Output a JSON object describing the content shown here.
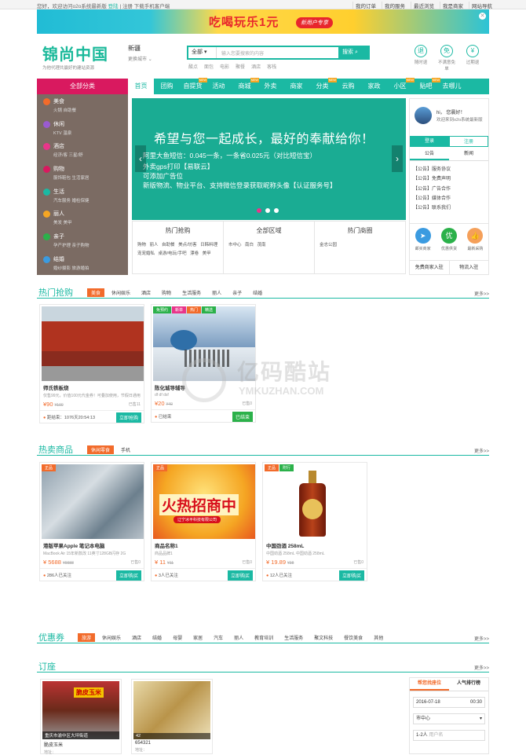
{
  "topbar": {
    "welcome": "您好，欢迎访问o2o系统最新版",
    "login": "登陆",
    "register": "注册",
    "download": "下载手机客户端",
    "links": [
      "我的订单",
      "我的服务",
      "最近浏览",
      "我是商家",
      "网站导航"
    ]
  },
  "banner": {
    "title": "吃喝玩乐1元",
    "sub": "新用户专享"
  },
  "logo": {
    "name": "锦尚中国",
    "slogan": "为他代理共赢好的建站资源"
  },
  "city": {
    "name": "新疆",
    "switch": "更换城市"
  },
  "search": {
    "select": "全部",
    "placeholder": "输入您要搜索的内容",
    "button": "搜索",
    "hot": [
      "酸点",
      "面包",
      "电影",
      "聚餐",
      "酒店",
      "客栈"
    ]
  },
  "badges": [
    {
      "c": "退",
      "t": "随时退"
    },
    {
      "c": "免",
      "t": "不满意免单"
    },
    {
      "c": "¥",
      "t": "过期退"
    }
  ],
  "nav": {
    "all": "全部分类",
    "items": [
      {
        "l": "首页",
        "n": false
      },
      {
        "l": "团购",
        "n": false
      },
      {
        "l": "自提货",
        "n": true
      },
      {
        "l": "活动",
        "n": false
      },
      {
        "l": "商城",
        "n": true
      },
      {
        "l": "外卖",
        "n": false
      },
      {
        "l": "商家",
        "n": false
      },
      {
        "l": "分类",
        "n": true
      },
      {
        "l": "云购",
        "n": false
      },
      {
        "l": "家政",
        "n": false
      },
      {
        "l": "小区",
        "n": true
      },
      {
        "l": "贴吧",
        "n": true
      },
      {
        "l": "去哪儿",
        "n": false
      }
    ]
  },
  "cats": [
    {
      "h": "美食",
      "s": "火锅  自助餐",
      "c": "#f26b2b"
    },
    {
      "h": "休闲",
      "s": "KTV  温泉",
      "c": "#9a5bd1"
    },
    {
      "h": "酒店",
      "s": "经济/客  三星/舒",
      "c": "#e8358a"
    },
    {
      "h": "购物",
      "s": "服饰鞋包  生活家居",
      "c": "#d9195f"
    },
    {
      "h": "生活",
      "s": "汽车服务  婚检保健",
      "c": "#1bb9a3"
    },
    {
      "h": "丽人",
      "s": "美发  美甲",
      "c": "#f5a623"
    },
    {
      "h": "亲子",
      "s": "孕产护理  亲子购物",
      "c": "#2bb14a"
    },
    {
      "h": "结婚",
      "s": "婚纱摄影  旅游婚拍",
      "c": "#3b9be0"
    }
  ],
  "slide": {
    "headline": "希望与您一起成长，最好的奉献给你！",
    "lines": [
      "阿里大鱼短信：0.045一条，一条省0.025元（对比短信宝）",
      "外卖gps打印【易联云】",
      "可添加广告位",
      "新版物流、物业平台、支持微信登录获取昵称头像【认证服务号】"
    ]
  },
  "quick": [
    {
      "h": "热门抢购",
      "l": "购物  丽人  自助餐  美点/坊客  日韩料理  宠宠婚私  桌游/电玩/手吧  漂卷  美甲"
    },
    {
      "h": "全部区域",
      "l": "市中心  南白  茂南"
    },
    {
      "h": "热门商圈",
      "l": "金志公园"
    }
  ],
  "user": {
    "hi": "hi，  您晨好！",
    "welcome": "欢迎来到o2o系统最新版",
    "login": "登录",
    "register": "注册",
    "tabs": [
      "公告",
      "新闻"
    ],
    "ann": [
      "【公告】服务协议",
      "【公告】免费声明",
      "【公告】广告合作",
      "【公告】媒体合作",
      "【公告】联系我们"
    ],
    "icons": [
      {
        "c": "➤",
        "t": "邮买商家",
        "col": "#3b9be0"
      },
      {
        "c": "优",
        "t": "优惠供货",
        "col": "#2bb14a"
      },
      {
        "c": "👍",
        "t": "最新采购",
        "col": "#f26b2b"
      }
    ],
    "foot": [
      "免费商家入驻",
      "物流入驻"
    ]
  },
  "sec1": {
    "title": "热门抢购",
    "tags": [
      "美食",
      "休闲娱乐",
      "酒店",
      "购物",
      "生活服务",
      "丽人",
      "亲子",
      "结婚"
    ],
    "more": "更多>>"
  },
  "sec2": {
    "title": "热卖商品",
    "tags": [
      "休闲零食",
      "手机"
    ],
    "more": "更多>>"
  },
  "sec3": {
    "title": "优惠券",
    "tags": [
      "旅游",
      "休闲娱乐",
      "酒店",
      "结婚",
      "母婴",
      "家居",
      "汽车",
      "丽人",
      "教育培训",
      "生活服务",
      "聚文科技",
      "餐饮美食",
      "其他"
    ],
    "more": "更多>>"
  },
  "sec4": {
    "title": "订座",
    "more": "更多>>"
  },
  "deals": [
    {
      "nm": "师氏铁板烧",
      "ds": "仅售99元，价值100元代金券！可叠加使用，节假日通用",
      "pr": "¥90",
      "old": "¥100",
      "sold": "已售11",
      "l": "距结束：1076天20:54:13",
      "b": "立即抢购",
      "tags": []
    },
    {
      "nm": "陈化城导辅导",
      "ds": "df df  dsf",
      "pr": "¥20",
      "old": "¥40",
      "sold": "已售0",
      "l": "已结束",
      "b": "已结束",
      "tags": [
        {
          "t": "免预约",
          "c": "#2bb14a"
        },
        {
          "t": "新单",
          "c": "#e8358a"
        },
        {
          "t": "热门",
          "c": "#f26b2b"
        },
        {
          "t": "精选",
          "c": "#2bb14a"
        }
      ]
    }
  ],
  "products": [
    {
      "nm": "港版苹果Apple 笔记本电脑",
      "ds": "MacBook Air 15年新款改 11英寸128GB闪存 2G",
      "pr": "¥ 5688",
      "old": "¥9988",
      "sold": "已售0",
      "l": "286人已关注",
      "b": "立即购买",
      "tags": [
        {
          "t": "正品",
          "c": "#f26b2b"
        }
      ]
    },
    {
      "nm": "商品名称1",
      "ds": "商品品牌1",
      "pr": "¥ 11",
      "old": "¥11",
      "sold": "已售0",
      "l": "3人已关注",
      "b": "立即购买",
      "tags": [
        {
          "t": "正品",
          "c": "#f26b2b"
        }
      ]
    },
    {
      "nm": "中国劲酒  258mL",
      "ds": "中国劲酒 258mL 中国劲酒 258mL",
      "pr": "¥ 19.89",
      "old": "¥38",
      "sold": "已售0",
      "l": "12人已关注",
      "b": "立即购买",
      "tags": [
        {
          "t": "正品",
          "c": "#f26b2b"
        },
        {
          "t": "附行",
          "c": "#2bb14a"
        }
      ]
    }
  ],
  "seats": [
    {
      "nm": "脆皮玉米",
      "ad": "重庆市渝中区大坪街道",
      "ds": "地址：",
      "pr": "",
      "tg": "脆皮玉米"
    },
    {
      "nm": "654321",
      "ad": "",
      "ds": "地址：",
      "pr": "",
      "tg": "42"
    }
  ],
  "booking": {
    "tabs": [
      "帮您找座位",
      "人气排行榜"
    ],
    "date": "2016-07-18",
    "time": "00:30",
    "area": "市中心",
    "people": "1-2人",
    "ph": "用户名"
  },
  "watermark": {
    "t1": "亿码酷站",
    "t2": "YMKUZHAN.COM"
  }
}
